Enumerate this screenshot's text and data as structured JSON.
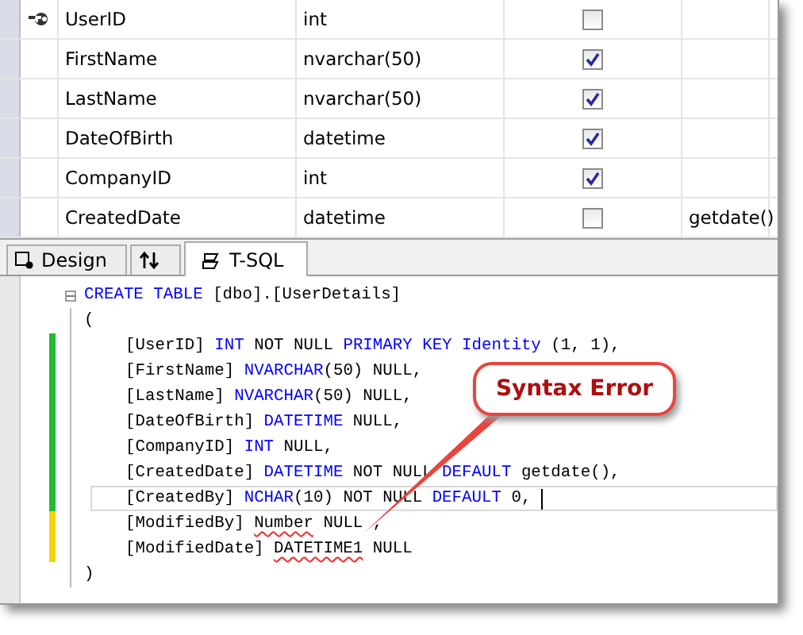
{
  "grid": {
    "rows": [
      {
        "name": "UserID",
        "type": "int",
        "allow_nulls": false,
        "primary_key": true
      },
      {
        "name": "FirstName",
        "type": "nvarchar(50)",
        "allow_nulls": true,
        "primary_key": false
      },
      {
        "name": "LastName",
        "type": "nvarchar(50)",
        "allow_nulls": true,
        "primary_key": false
      },
      {
        "name": "DateOfBirth",
        "type": "datetime",
        "allow_nulls": true,
        "primary_key": false
      },
      {
        "name": "CompanyID",
        "type": "int",
        "allow_nulls": true,
        "primary_key": false
      },
      {
        "name": "CreatedDate",
        "type": "datetime",
        "allow_nulls": false,
        "primary_key": false,
        "default": "getdate()"
      }
    ]
  },
  "tabs": [
    {
      "kind": "design",
      "label": "Design",
      "selected": false
    },
    {
      "kind": "swap",
      "selected": false
    },
    {
      "kind": "tsql",
      "label": "T-SQL",
      "selected": true
    }
  ],
  "code": {
    "lines": [
      {
        "fold": true,
        "tokens": [
          {
            "kind": "kw",
            "text": "CREATE TABLE"
          },
          {
            "kind": "plain",
            "text": " [dbo].[UserDetails]"
          }
        ]
      },
      {
        "fold": false,
        "tokens": [
          {
            "kind": "plain",
            "text": "("
          }
        ],
        "children": [
          {
            "color": "#22bb33",
            "current": false,
            "tokens": [
              {
                "kind": "plain",
                "text": "[UserID] "
              },
              {
                "kind": "kw",
                "text": "INT"
              },
              {
                "kind": "plain",
                "text": " NOT NULL "
              },
              {
                "kind": "kw",
                "text": "PRIMARY KEY Identity"
              },
              {
                "kind": "plain",
                "text": " (1, 1),"
              }
            ]
          },
          {
            "color": "#22bb33",
            "current": false,
            "tokens": [
              {
                "kind": "plain",
                "text": "[FirstName] "
              },
              {
                "kind": "kw",
                "text": "NVARCHAR"
              },
              {
                "kind": "plain",
                "text": "(50) NULL,"
              }
            ]
          },
          {
            "color": "#22bb33",
            "current": false,
            "tokens": [
              {
                "kind": "plain",
                "text": "[LastName] "
              },
              {
                "kind": "kw",
                "text": "NVARCHAR"
              },
              {
                "kind": "plain",
                "text": "(50) NULL,"
              }
            ]
          },
          {
            "color": "#22bb33",
            "current": false,
            "tokens": [
              {
                "kind": "plain",
                "text": "[DateOfBirth] "
              },
              {
                "kind": "kw",
                "text": "DATETIME"
              },
              {
                "kind": "plain",
                "text": " NULL,"
              }
            ]
          },
          {
            "color": "#22bb33",
            "current": false,
            "tokens": [
              {
                "kind": "plain",
                "text": "[CompanyID] "
              },
              {
                "kind": "kw",
                "text": "INT"
              },
              {
                "kind": "plain",
                "text": " NULL,"
              }
            ]
          },
          {
            "color": "#22bb33",
            "current": false,
            "tokens": [
              {
                "kind": "plain",
                "text": "[CreatedDate] "
              },
              {
                "kind": "kw",
                "text": "DATETIME"
              },
              {
                "kind": "plain",
                "text": " NOT NULL "
              },
              {
                "kind": "kw",
                "text": "DEFAULT"
              },
              {
                "kind": "plain",
                "text": " getdate(),"
              }
            ]
          },
          {
            "color": "#22bb33",
            "current": true,
            "tokens": [
              {
                "kind": "plain",
                "text": "[CreatedBy] "
              },
              {
                "kind": "kw",
                "text": "NCHAR"
              },
              {
                "kind": "plain",
                "text": "(10) NOT NULL "
              },
              {
                "kind": "kw",
                "text": "DEFAULT"
              },
              {
                "kind": "plain",
                "text": " 0,"
              }
            ]
          },
          {
            "color": "#f2d600",
            "current": false,
            "tokens": [
              {
                "kind": "plain",
                "text": "[ModifiedBy] "
              },
              {
                "kind": "error",
                "text": "Number"
              },
              {
                "kind": "plain",
                "text": " NULL ,"
              }
            ]
          },
          {
            "color": "#f2d600",
            "current": false,
            "tokens": [
              {
                "kind": "plain",
                "text": "[ModifiedDate] "
              },
              {
                "kind": "error",
                "text": "DATETIME1"
              },
              {
                "kind": "plain",
                "text": " NULL"
              }
            ]
          }
        ]
      },
      {
        "fold": false,
        "tokens": [
          {
            "kind": "plain",
            "text": ")"
          }
        ]
      }
    ]
  },
  "callout": {
    "text": "Syntax Error"
  }
}
